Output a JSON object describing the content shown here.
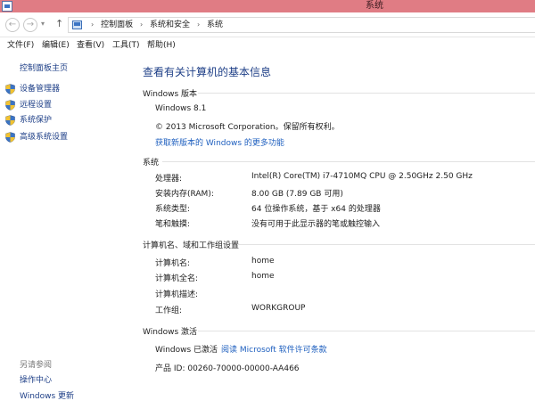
{
  "window": {
    "title": "系统"
  },
  "nav": {
    "back_icon": "back-arrow-icon",
    "forward_icon": "forward-arrow-icon",
    "breadcrumbs": [
      "控制面板",
      "系统和安全",
      "系统"
    ]
  },
  "menu": {
    "file": "文件(F)",
    "edit": "编辑(E)",
    "view": "查看(V)",
    "tools": "工具(T)",
    "help": "帮助(H)"
  },
  "sidebar": {
    "home": "控制面板主页",
    "items": [
      {
        "label": "设备管理器",
        "icon": "shield-icon"
      },
      {
        "label": "远程设置",
        "icon": "shield-icon"
      },
      {
        "label": "系统保护",
        "icon": "shield-icon"
      },
      {
        "label": "高级系统设置",
        "icon": "shield-icon"
      }
    ],
    "see_also_label": "另请参阅",
    "see_also": [
      "操作中心",
      "Windows 更新"
    ]
  },
  "main": {
    "title": "查看有关计算机的基本信息",
    "edition": {
      "heading": "Windows 版本",
      "name": "Windows 8.1",
      "copyright": "© 2013 Microsoft Corporation。保留所有权利。",
      "more_features_link": "获取新版本的 Windows 的更多功能"
    },
    "system": {
      "heading": "系统",
      "rows": [
        {
          "label": "处理器:",
          "value": "Intel(R) Core(TM) i7-4710MQ CPU @ 2.50GHz   2.50 GHz"
        },
        {
          "label": "安装内存(RAM):",
          "value": "8.00 GB (7.89 GB 可用)"
        },
        {
          "label": "系统类型:",
          "value": "64 位操作系统，基于 x64 的处理器"
        },
        {
          "label": "笔和触摸:",
          "value": "没有可用于此显示器的笔或触控输入"
        }
      ]
    },
    "computer": {
      "heading": "计算机名、域和工作组设置",
      "rows": [
        {
          "label": "计算机名:",
          "value": "home"
        },
        {
          "label": "计算机全名:",
          "value": "home"
        },
        {
          "label": "计算机描述:",
          "value": ""
        },
        {
          "label": "工作组:",
          "value": "WORKGROUP"
        }
      ]
    },
    "activation": {
      "heading": "Windows 激活",
      "status": "Windows 已激活",
      "license_link": "阅读 Microsoft 软件许可条款",
      "product_id": "产品 ID: 00260-70000-00000-AA466"
    }
  },
  "colors": {
    "titlebar": "#e07c84",
    "link": "#1e3f87",
    "accent_link": "#1e5fbf"
  }
}
